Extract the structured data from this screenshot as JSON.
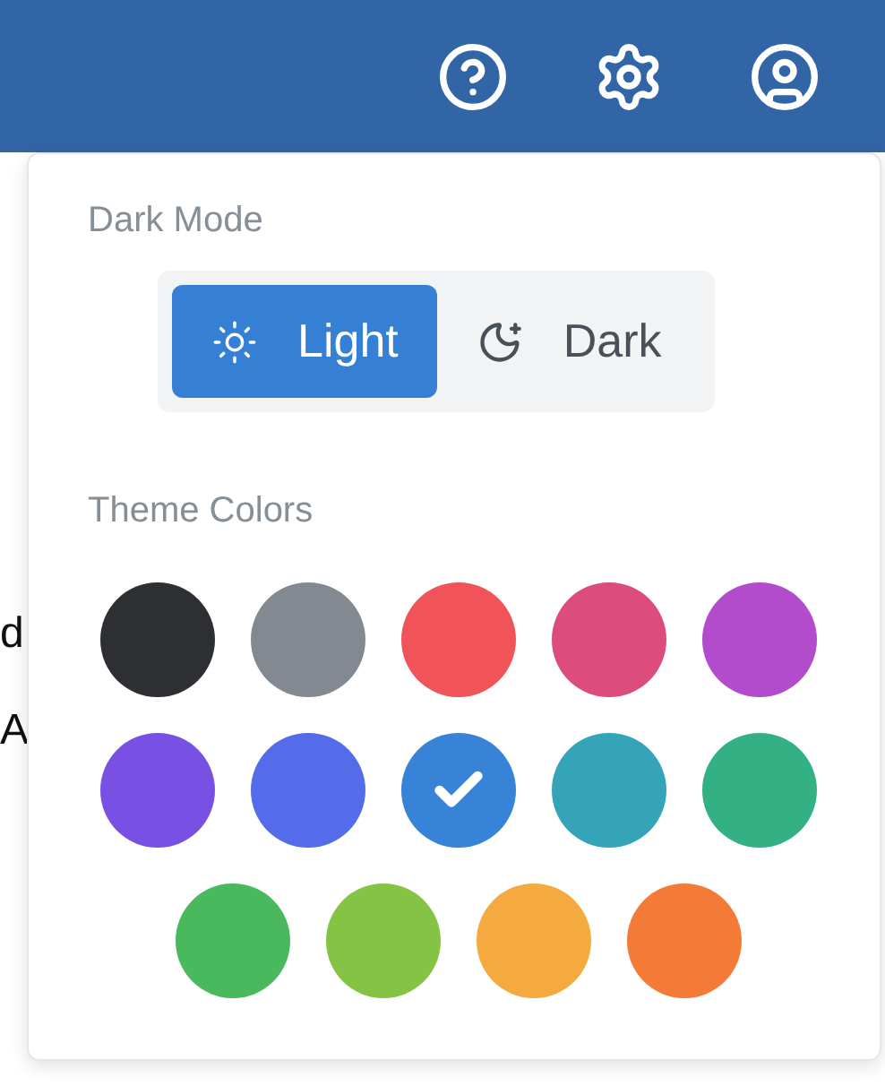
{
  "background_text": [
    "d",
    "A"
  ],
  "dark_mode": {
    "title": "Dark Mode",
    "options": [
      {
        "label": "Light",
        "kind": "sun",
        "selected": true
      },
      {
        "label": "Dark",
        "kind": "moon",
        "selected": false
      }
    ]
  },
  "theme_colors": {
    "title": "Theme Colors",
    "swatches": [
      {
        "color": "#2e2f33",
        "selected": false
      },
      {
        "color": "#838990",
        "selected": false
      },
      {
        "color": "#f05459",
        "selected": false
      },
      {
        "color": "#dc4c7c",
        "selected": false
      },
      {
        "color": "#b34ccc",
        "selected": false
      },
      {
        "color": "#7950e4",
        "selected": false
      },
      {
        "color": "#546cea",
        "selected": false
      },
      {
        "color": "#3683d7",
        "selected": true
      },
      {
        "color": "#35a4b8",
        "selected": false
      },
      {
        "color": "#33b184",
        "selected": false
      },
      {
        "color": "#4ab95d",
        "selected": false
      },
      {
        "color": "#84c343",
        "selected": false
      },
      {
        "color": "#f4aa3e",
        "selected": false
      },
      {
        "color": "#f47a37",
        "selected": false
      }
    ]
  }
}
